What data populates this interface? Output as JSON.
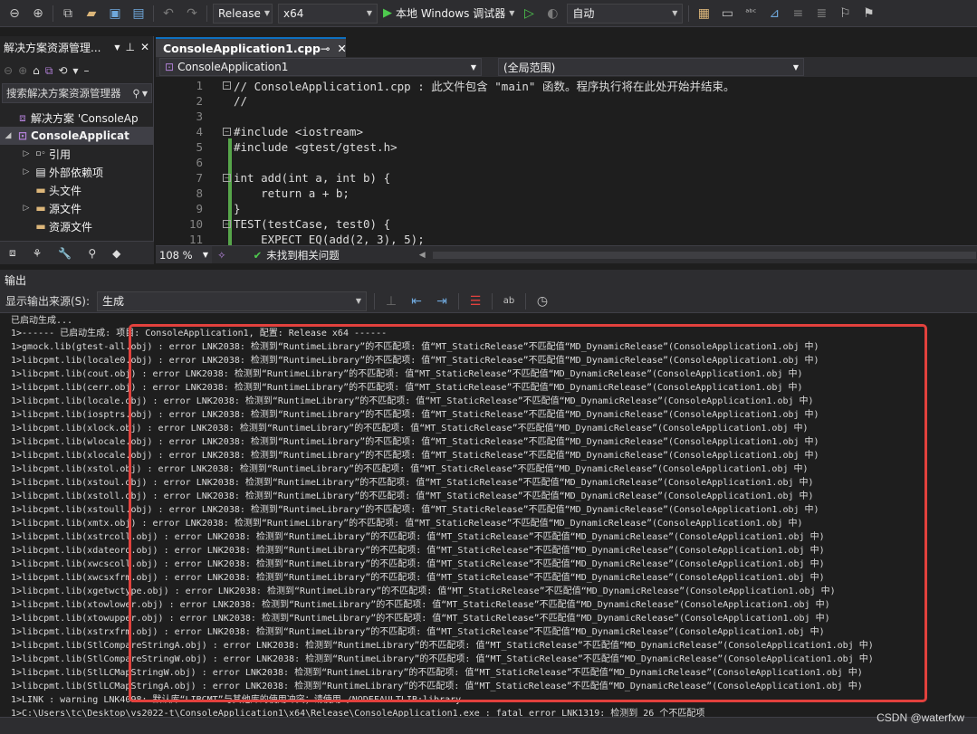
{
  "toolbar": {
    "configuration": "Release",
    "platform": "x64",
    "debugger": "本地 Windows 调试器",
    "mode": "自动"
  },
  "solution_explorer": {
    "title": "解决方案资源管理...",
    "search_placeholder": "搜索解决方案资源管理器",
    "items": [
      {
        "label": "解决方案 'ConsoleAp"
      },
      {
        "label": "ConsoleApplicat"
      },
      {
        "label": "引用"
      },
      {
        "label": "外部依赖项"
      },
      {
        "label": "头文件"
      },
      {
        "label": "源文件"
      },
      {
        "label": "资源文件"
      }
    ]
  },
  "editor": {
    "tab_title": "ConsoleApplication1.cpp",
    "nav_left": "ConsoleApplication1",
    "nav_right": "(全局范围)",
    "zoom": "108 %",
    "issues": "未找到相关问题",
    "lines": [
      {
        "num": "1",
        "text": "// ConsoleApplication1.cpp : 此文件包含 \"main\" 函数。程序执行将在此处开始并结束。"
      },
      {
        "num": "2",
        "text": "//"
      },
      {
        "num": "3",
        "text": ""
      },
      {
        "num": "4",
        "text": "#include <iostream>"
      },
      {
        "num": "5",
        "text": "#include <gtest/gtest.h>"
      },
      {
        "num": "6",
        "text": ""
      },
      {
        "num": "7",
        "text": "int add(int a, int b) {"
      },
      {
        "num": "8",
        "text": "    return a + b;"
      },
      {
        "num": "9",
        "text": "}"
      },
      {
        "num": "10",
        "text": "TEST(testCase, test0) {"
      },
      {
        "num": "11",
        "text": "    EXPECT_EQ(add(2, 3), 5);"
      }
    ]
  },
  "output": {
    "title": "输出",
    "source_label": "显示输出来源(S):",
    "source_value": "生成",
    "lines": [
      "已启动生成...",
      "1>------ 已启动生成: 项目: ConsoleApplication1, 配置: Release x64 ------",
      "1>gmock.lib(gtest-all.obj) : error LNK2038: 检测到“RuntimeLibrary”的不匹配项: 值“MT_StaticRelease”不匹配值“MD_DynamicRelease”(ConsoleApplication1.obj 中)",
      "1>libcpmt.lib(locale0.obj) : error LNK2038: 检测到“RuntimeLibrary”的不匹配项: 值“MT_StaticRelease”不匹配值“MD_DynamicRelease”(ConsoleApplication1.obj 中)",
      "1>libcpmt.lib(cout.obj) : error LNK2038: 检测到“RuntimeLibrary”的不匹配项: 值“MT_StaticRelease”不匹配值“MD_DynamicRelease”(ConsoleApplication1.obj 中)",
      "1>libcpmt.lib(cerr.obj) : error LNK2038: 检测到“RuntimeLibrary”的不匹配项: 值“MT_StaticRelease”不匹配值“MD_DynamicRelease”(ConsoleApplication1.obj 中)",
      "1>libcpmt.lib(locale.obj) : error LNK2038: 检测到“RuntimeLibrary”的不匹配项: 值“MT_StaticRelease”不匹配值“MD_DynamicRelease”(ConsoleApplication1.obj 中)",
      "1>libcpmt.lib(iosptrs.obj) : error LNK2038: 检测到“RuntimeLibrary”的不匹配项: 值“MT_StaticRelease”不匹配值“MD_DynamicRelease”(ConsoleApplication1.obj 中)",
      "1>libcpmt.lib(xlock.obj) : error LNK2038: 检测到“RuntimeLibrary”的不匹配项: 值“MT_StaticRelease”不匹配值“MD_DynamicRelease”(ConsoleApplication1.obj 中)",
      "1>libcpmt.lib(wlocale.obj) : error LNK2038: 检测到“RuntimeLibrary”的不匹配项: 值“MT_StaticRelease”不匹配值“MD_DynamicRelease”(ConsoleApplication1.obj 中)",
      "1>libcpmt.lib(xlocale.obj) : error LNK2038: 检测到“RuntimeLibrary”的不匹配项: 值“MT_StaticRelease”不匹配值“MD_DynamicRelease”(ConsoleApplication1.obj 中)",
      "1>libcpmt.lib(xstol.obj) : error LNK2038: 检测到“RuntimeLibrary”的不匹配项: 值“MT_StaticRelease”不匹配值“MD_DynamicRelease”(ConsoleApplication1.obj 中)",
      "1>libcpmt.lib(xstoul.obj) : error LNK2038: 检测到“RuntimeLibrary”的不匹配项: 值“MT_StaticRelease”不匹配值“MD_DynamicRelease”(ConsoleApplication1.obj 中)",
      "1>libcpmt.lib(xstoll.obj) : error LNK2038: 检测到“RuntimeLibrary”的不匹配项: 值“MT_StaticRelease”不匹配值“MD_DynamicRelease”(ConsoleApplication1.obj 中)",
      "1>libcpmt.lib(xstoull.obj) : error LNK2038: 检测到“RuntimeLibrary”的不匹配项: 值“MT_StaticRelease”不匹配值“MD_DynamicRelease”(ConsoleApplication1.obj 中)",
      "1>libcpmt.lib(xmtx.obj) : error LNK2038: 检测到“RuntimeLibrary”的不匹配项: 值“MT_StaticRelease”不匹配值“MD_DynamicRelease”(ConsoleApplication1.obj 中)",
      "1>libcpmt.lib(xstrcoll.obj) : error LNK2038: 检测到“RuntimeLibrary”的不匹配项: 值“MT_StaticRelease”不匹配值“MD_DynamicRelease”(ConsoleApplication1.obj 中)",
      "1>libcpmt.lib(xdateord.obj) : error LNK2038: 检测到“RuntimeLibrary”的不匹配项: 值“MT_StaticRelease”不匹配值“MD_DynamicRelease”(ConsoleApplication1.obj 中)",
      "1>libcpmt.lib(xwcscoll.obj) : error LNK2038: 检测到“RuntimeLibrary”的不匹配项: 值“MT_StaticRelease”不匹配值“MD_DynamicRelease”(ConsoleApplication1.obj 中)",
      "1>libcpmt.lib(xwcsxfrm.obj) : error LNK2038: 检测到“RuntimeLibrary”的不匹配项: 值“MT_StaticRelease”不匹配值“MD_DynamicRelease”(ConsoleApplication1.obj 中)",
      "1>libcpmt.lib(xgetwctype.obj) : error LNK2038: 检测到“RuntimeLibrary”的不匹配项: 值“MT_StaticRelease”不匹配值“MD_DynamicRelease”(ConsoleApplication1.obj 中)",
      "1>libcpmt.lib(xtowlower.obj) : error LNK2038: 检测到“RuntimeLibrary”的不匹配项: 值“MT_StaticRelease”不匹配值“MD_DynamicRelease”(ConsoleApplication1.obj 中)",
      "1>libcpmt.lib(xtowupper.obj) : error LNK2038: 检测到“RuntimeLibrary”的不匹配项: 值“MT_StaticRelease”不匹配值“MD_DynamicRelease”(ConsoleApplication1.obj 中)",
      "1>libcpmt.lib(xstrxfrm.obj) : error LNK2038: 检测到“RuntimeLibrary”的不匹配项: 值“MT_StaticRelease”不匹配值“MD_DynamicRelease”(ConsoleApplication1.obj 中)",
      "1>libcpmt.lib(StlCompareStringA.obj) : error LNK2038: 检测到“RuntimeLibrary”的不匹配项: 值“MT_StaticRelease”不匹配值“MD_DynamicRelease”(ConsoleApplication1.obj 中)",
      "1>libcpmt.lib(StlCompareStringW.obj) : error LNK2038: 检测到“RuntimeLibrary”的不匹配项: 值“MT_StaticRelease”不匹配值“MD_DynamicRelease”(ConsoleApplication1.obj 中)",
      "1>libcpmt.lib(StlLCMapStringW.obj) : error LNK2038: 检测到“RuntimeLibrary”的不匹配项: 值“MT_StaticRelease”不匹配值“MD_DynamicRelease”(ConsoleApplication1.obj 中)",
      "1>libcpmt.lib(StlLCMapStringA.obj) : error LNK2038: 检测到“RuntimeLibrary”的不匹配项: 值“MT_StaticRelease”不匹配值“MD_DynamicRelease”(ConsoleApplication1.obj 中)",
      "1>LINK : warning LNK4098: 默认库“LIBCMT”与其他库的使用冲突；请使用 /NODEFAULTLIB:library",
      "1>C:\\Users\\tc\\Desktop\\vs2022-t\\ConsoleApplication1\\x64\\Release\\ConsoleApplication1.exe : fatal error LNK1319: 检测到 26 个不匹配项"
    ]
  },
  "watermark": "CSDN @waterfxw"
}
